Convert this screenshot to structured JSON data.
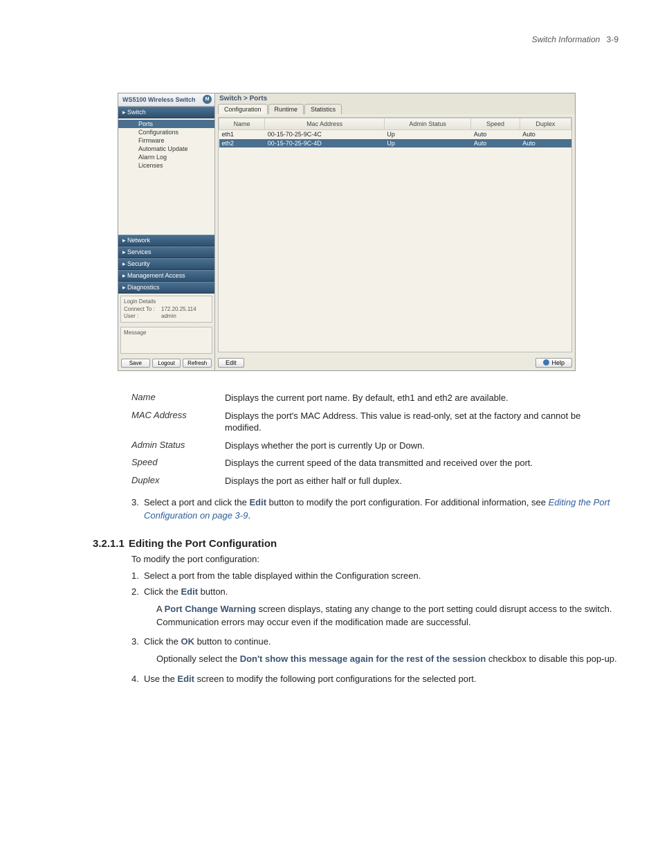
{
  "header": {
    "title": "Switch Information",
    "page": "3-9"
  },
  "screenshot": {
    "product": "WS5100 Wireless Switch",
    "logo_letter": "M",
    "nav_sections": {
      "switch": "▸  Switch",
      "network": "▸  Network",
      "services": "▸  Services",
      "security": "▸  Security",
      "mgmt": "▸  Management Access",
      "diag": "▸  Diagnostics"
    },
    "tree": {
      "ports": "Ports",
      "config": "Configurations",
      "firmware": "Firmware",
      "autoupd": "Automatic Update",
      "alarmlog": "Alarm Log",
      "licenses": "Licenses"
    },
    "login": {
      "title": "Login Details",
      "connect_lbl": "Connect To :",
      "connect_val": "172.20.25.114",
      "user_lbl": "User :",
      "user_val": "admin"
    },
    "message_title": "Message",
    "side_buttons": {
      "save": "Save",
      "logout": "Logout",
      "refresh": "Refresh"
    },
    "breadcrumb": "Switch > Ports",
    "tabs": {
      "config": "Configuration",
      "runtime": "Runtime",
      "stats": "Statistics"
    },
    "columns": {
      "name": "Name",
      "mac": "Mac Address",
      "admin": "Admin Status",
      "speed": "Speed",
      "duplex": "Duplex"
    },
    "rows": [
      {
        "name": "eth1",
        "mac": "00-15-70-25-9C-4C",
        "admin": "Up",
        "speed": "Auto",
        "duplex": "Auto"
      },
      {
        "name": "eth2",
        "mac": "00-15-70-25-9C-4D",
        "admin": "Up",
        "speed": "Auto",
        "duplex": "Auto"
      }
    ],
    "edit_btn": "Edit",
    "help_btn": "Help"
  },
  "definitions": [
    {
      "term": "Name",
      "desc": "Displays the current port name. By default, eth1 and eth2 are available."
    },
    {
      "term": "MAC Address",
      "desc": "Displays the port's MAC Address. This value is read-only, set at the factory and cannot be modified."
    },
    {
      "term": "Admin Status",
      "desc": "Displays whether the port is currently Up or Down."
    },
    {
      "term": "Speed",
      "desc": "Displays the current speed of the data transmitted and received over the port."
    },
    {
      "term": "Duplex",
      "desc": "Displays the port as either half or full duplex."
    }
  ],
  "step3": {
    "pre": "Select a port and click the ",
    "kw": "Edit",
    "mid": " button to modify the port configuration. For additional information, see ",
    "link": "Editing the Port Configuration on page 3-9",
    "post": "."
  },
  "section": {
    "num": "3.2.1.1",
    "title": "Editing the Port Configuration"
  },
  "intro": "To modify the port configuration:",
  "steps": {
    "s1": "Select a port from the table displayed within the Configuration screen.",
    "s2_a": "Click the ",
    "s2_kw": "Edit",
    "s2_b": " button.",
    "s2_sub_a": "A ",
    "s2_sub_kw": "Port Change Warning",
    "s2_sub_b": " screen displays, stating any change to the port setting could disrupt access to the switch. Communication errors may occur even if the modification made are successful.",
    "s3_a": "Click the ",
    "s3_kw": "OK",
    "s3_b": " button to continue.",
    "s3_sub_a": "Optionally select the ",
    "s3_sub_kw": "Don't show this message again for the rest of the session",
    "s3_sub_b": " checkbox to disable this pop-up.",
    "s4_a": "Use the ",
    "s4_kw": "Edit",
    "s4_b": " screen to modify the following port configurations for the selected port."
  }
}
